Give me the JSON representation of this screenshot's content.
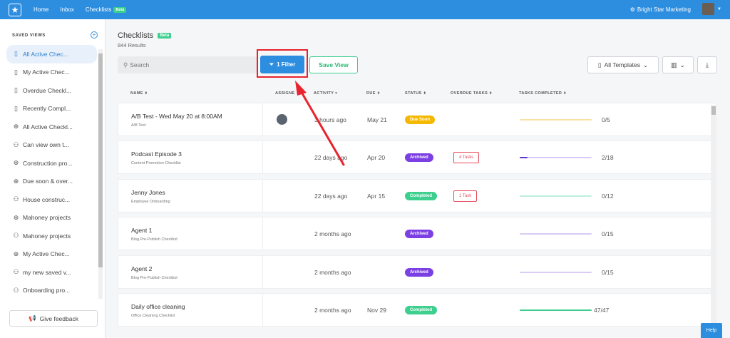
{
  "topbar": {
    "nav": [
      {
        "label": "Home"
      },
      {
        "label": "Inbox"
      },
      {
        "label": "Checklists",
        "badge": "Beta"
      }
    ],
    "org_name": "Bright Star Marketing"
  },
  "sidebar": {
    "title": "SAVED VIEWS",
    "items": [
      {
        "label": "All Active Chec...",
        "icon": "book-icon"
      },
      {
        "label": "My Active Chec...",
        "icon": "book-icon"
      },
      {
        "label": "Overdue Checkl...",
        "icon": "book-icon"
      },
      {
        "label": "Recently Compl...",
        "icon": "book-icon"
      },
      {
        "label": "All Active Checkl...",
        "icon": "globe-icon"
      },
      {
        "label": "Can view own t...",
        "icon": "users-icon"
      },
      {
        "label": "Construction pro...",
        "icon": "globe-icon"
      },
      {
        "label": "Due soon & over...",
        "icon": "globe-icon"
      },
      {
        "label": "House construc...",
        "icon": "users-icon"
      },
      {
        "label": "Mahoney projects",
        "icon": "globe-icon"
      },
      {
        "label": "Mahoney projects",
        "icon": "users-icon"
      },
      {
        "label": "My Active Chec...",
        "icon": "globe-icon"
      },
      {
        "label": "my new saved v...",
        "icon": "users-icon"
      },
      {
        "label": "Onboarding pro...",
        "icon": "users-icon"
      }
    ],
    "feedback_label": "Give feedback"
  },
  "main": {
    "title": "Checklists",
    "title_badge": "Beta",
    "results": "844 Results",
    "search_placeholder": "Search",
    "filter_label": "1 Filter",
    "save_view_label": "Save View",
    "templates_label": "All Templates",
    "columns": [
      "NAME",
      "ASSIGNE",
      "ACTIVITY",
      "DUE",
      "STATUS",
      "OVERDUE TASKS",
      "TASKS COMPLETED"
    ],
    "rows": [
      {
        "name": "A/B Test - Wed May 20 at 8:00AM",
        "template": "A/B Test",
        "assignee": true,
        "activity": "3 hours ago",
        "due": "May 21",
        "status": "Due Soon",
        "status_color": "#f5b800",
        "overdue": "",
        "progress": 0.0,
        "count": "0/5",
        "bar_color": "#f7e2a2",
        "fill_color": "#f5b800"
      },
      {
        "name": "Podcast Episode 3",
        "template": "Content Promotion Checklist",
        "assignee": false,
        "activity": "22 days ago",
        "due": "Apr 20",
        "status": "Archived",
        "status_color": "#7c3fe4",
        "overdue": "4 Tasks",
        "progress": 0.11,
        "count": "2/18",
        "bar_color": "#d9cbf5",
        "fill_color": "#5b35d5"
      },
      {
        "name": "Jenny Jones",
        "template": "Employee Onboarding",
        "assignee": false,
        "activity": "22 days ago",
        "due": "Apr 15",
        "status": "Completed",
        "status_color": "#3ccf8e",
        "overdue": "1 Task",
        "progress": 0.0,
        "count": "0/12",
        "bar_color": "#bfeedc",
        "fill_color": "#3ccf8e"
      },
      {
        "name": "Agent 1",
        "template": "Blog Pre-Publish Checklist",
        "assignee": false,
        "activity": "2 months ago",
        "due": "",
        "status": "Archived",
        "status_color": "#7c3fe4",
        "overdue": "",
        "progress": 0.0,
        "count": "0/15",
        "bar_color": "#d9cbf5",
        "fill_color": "#5b35d5"
      },
      {
        "name": "Agent 2",
        "template": "Blog Pre-Publish Checklist",
        "assignee": false,
        "activity": "2 months ago",
        "due": "",
        "status": "Archived",
        "status_color": "#7c3fe4",
        "overdue": "",
        "progress": 0.0,
        "count": "0/15",
        "bar_color": "#d9cbf5",
        "fill_color": "#5b35d5"
      },
      {
        "name": "Daily office cleaning",
        "template": "Office Cleaning Checklist",
        "assignee": false,
        "activity": "2 months ago",
        "due": "Nov 29",
        "status": "Completed",
        "status_color": "#3ccf8e",
        "overdue": "",
        "progress": 1.0,
        "count": "47/47",
        "bar_color": "#bfeedc",
        "fill_color": "#3ccf8e"
      }
    ]
  },
  "help_label": "Help",
  "colors": {
    "accent": "#2d8ee0",
    "highlight": "#e8232d",
    "success": "#3ccf8e"
  }
}
